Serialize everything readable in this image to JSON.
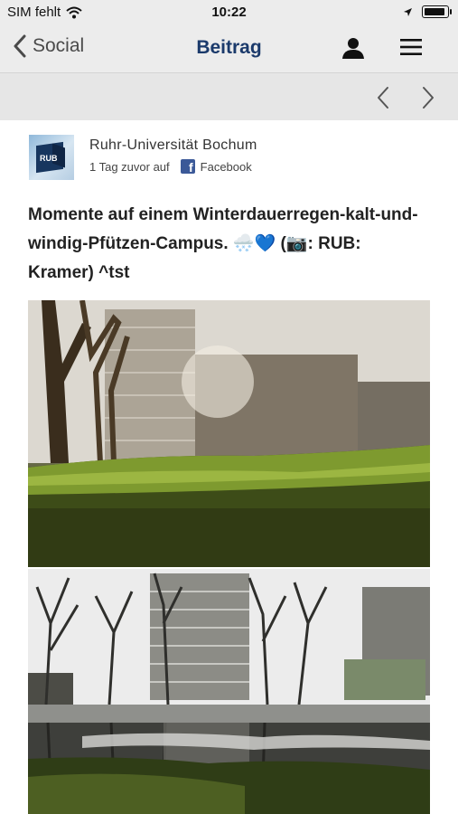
{
  "status_bar": {
    "carrier": "SIM fehlt",
    "time": "10:22"
  },
  "nav": {
    "back_label": "Social",
    "title": "Beitrag"
  },
  "post": {
    "author": "Ruhr-Universität Bochum",
    "logo_text": "RUB",
    "time_ago": "1 Tag zuvor auf",
    "source": "Facebook",
    "text": "Momente auf einem Winterdauerregen-kalt-und-windig-Pfützen-Campus. 🌨️💙 (📷: RUB: Kramer) ^tst"
  },
  "icons": {
    "wifi": "wifi-icon",
    "location": "location-arrow-icon",
    "battery": "battery-icon",
    "back": "chevron-left-icon",
    "user": "user-icon",
    "menu": "hamburger-menu-icon",
    "prev": "chevron-left-icon",
    "next": "chevron-right-icon",
    "facebook": "facebook-icon"
  },
  "colors": {
    "nav_title": "#1b3a6b",
    "bar_bg": "#ececec",
    "facebook": "#3b5998"
  }
}
